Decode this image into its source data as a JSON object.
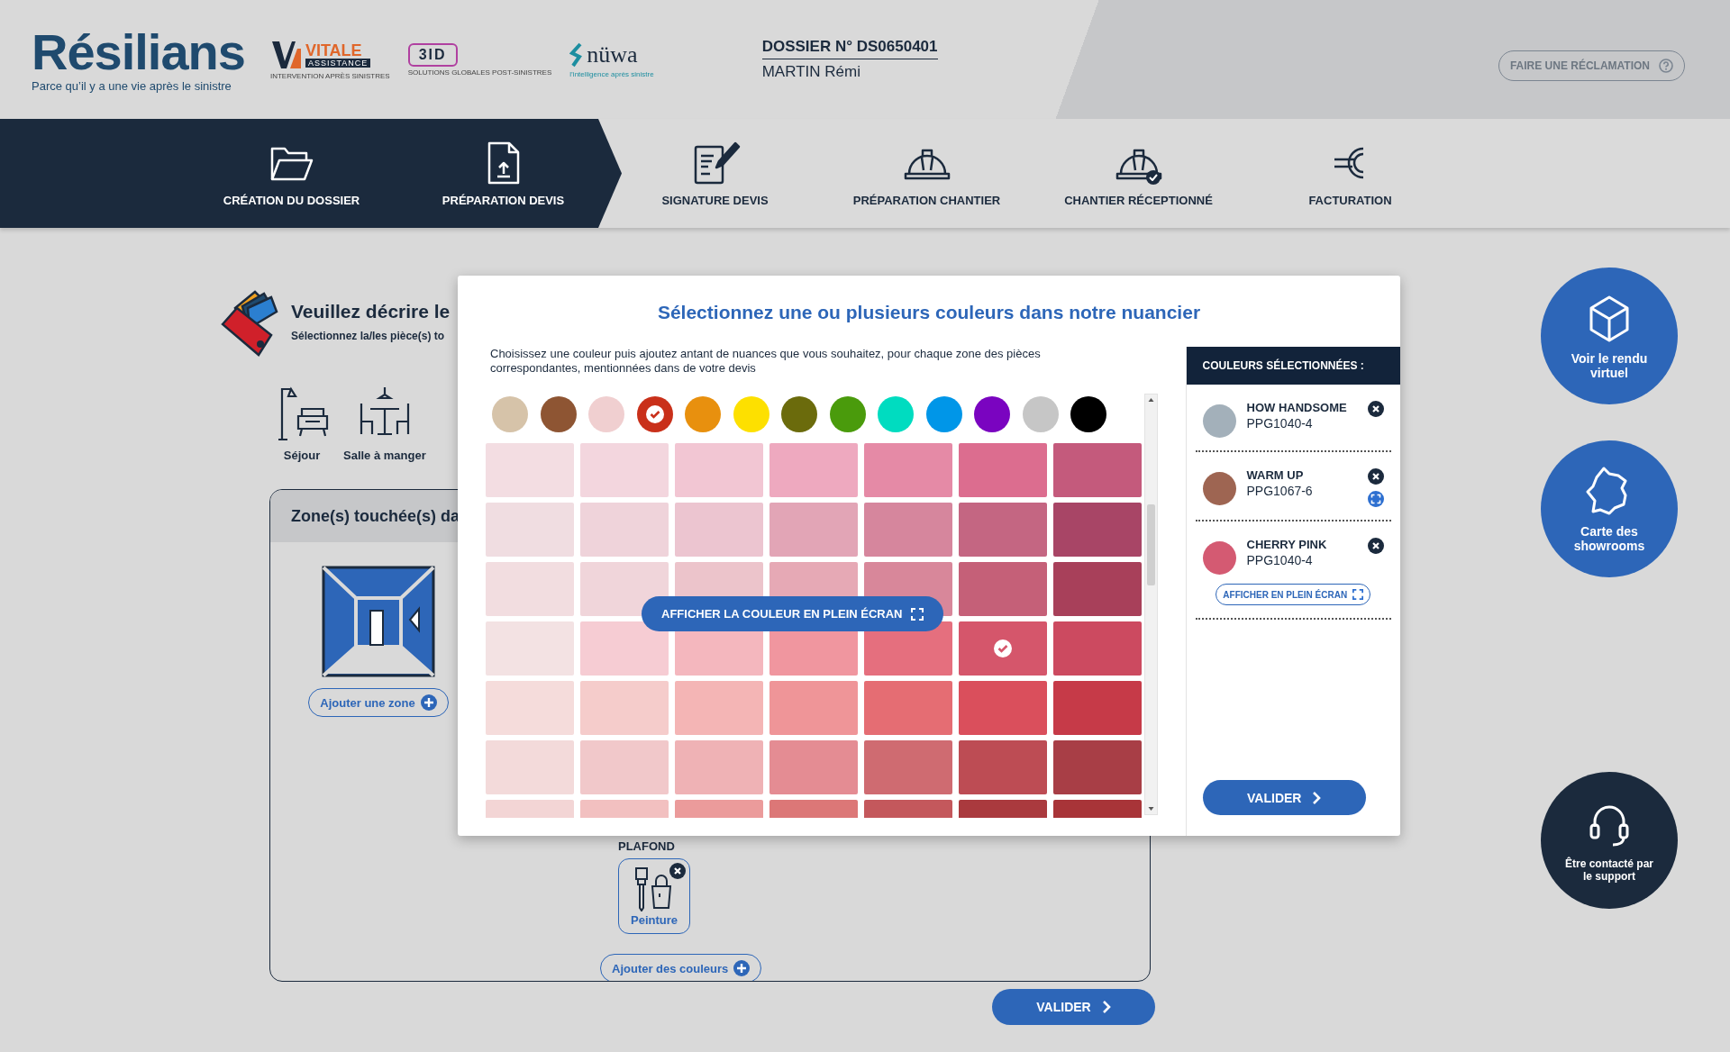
{
  "header": {
    "logo": {
      "name": "Résilians",
      "tagline": "Parce qu’il y a une vie après le sinistre"
    },
    "partners": [
      {
        "kind": "vitale",
        "name": "VITALE",
        "subtitle": "ASSISTANCE",
        "tagline": "INTERVENTION APRÈS SINISTRES"
      },
      {
        "kind": "threeid",
        "name": "3ID",
        "tagline": "SOLUTIONS GLOBALES POST-SINISTRES"
      },
      {
        "kind": "nuwa",
        "name": "nüwa",
        "tagline": "l’intelligence après sinistre"
      }
    ],
    "dossier": {
      "number": "DOSSIER N° DS0650401",
      "client": "MARTIN Rémi"
    },
    "claim_button": "FAIRE UNE RÉCLAMATION"
  },
  "steps": [
    {
      "kind": "folder",
      "label": "CRÉATION DU DOSSIER",
      "done": true
    },
    {
      "kind": "upload",
      "label": "PRÉPARATION DEVIS",
      "done": true
    },
    {
      "kind": "signature",
      "label": "SIGNATURE DEVIS",
      "done": false
    },
    {
      "kind": "helmet",
      "label": "PRÉPARATION CHANTIER",
      "done": false
    },
    {
      "kind": "helmetcheck",
      "label": "CHANTIER RÉCEPTIONNÉ",
      "done": false
    },
    {
      "kind": "euro",
      "label": "FACTURATION",
      "done": false
    }
  ],
  "page": {
    "title": "Veuillez décrire le",
    "subtitle": "Sélectionnez la/les pièce(s) to",
    "rooms": [
      {
        "kind": "living",
        "label": "Séjour"
      },
      {
        "kind": "dining",
        "label": "Salle à manger"
      }
    ],
    "zone_panel": {
      "title": "Zone(s) touchée(s) da",
      "add_zone": "Ajouter une zone",
      "section": "PLAFOND",
      "works": [
        {
          "label": "Peinture"
        }
      ],
      "add_colors": "Ajouter des couleurs"
    },
    "validate": "VALIDER"
  },
  "modal": {
    "title": "Sélectionnez une ou plusieurs couleurs dans notre nuancier",
    "intro": "Choisissez une couleur puis ajoutez antant de nuances que vous souhaitez, pour chaque zone des pièces correspondantes, mentionnées dans de votre devis",
    "swatches": [
      {
        "color": "#d6c3a9",
        "selected": false
      },
      {
        "color": "#8e5533",
        "selected": false
      },
      {
        "color": "#f0cfd0",
        "selected": false
      },
      {
        "color": "#c9301a",
        "selected": true
      },
      {
        "color": "#e8900e",
        "selected": false
      },
      {
        "color": "#fde000",
        "selected": false
      },
      {
        "color": "#6b6b0c",
        "selected": false
      },
      {
        "color": "#4a9b0c",
        "selected": false
      },
      {
        "color": "#00dcc0",
        "selected": false
      },
      {
        "color": "#0096e8",
        "selected": false
      },
      {
        "color": "#7a04c0",
        "selected": false
      },
      {
        "color": "#c6c6c6",
        "selected": false
      },
      {
        "color": "#000000",
        "selected": false
      }
    ],
    "shades": [
      {
        "cells": [
          {
            "color": "#f3dde2",
            "selected": false
          },
          {
            "color": "#f3d6de",
            "selected": false
          },
          {
            "color": "#f2c6d3",
            "selected": false
          },
          {
            "color": "#eea9bf",
            "selected": false
          },
          {
            "color": "#e58aa6",
            "selected": false
          },
          {
            "color": "#dc6d8f",
            "selected": false
          },
          {
            "color": "#c45a7c",
            "selected": false
          }
        ]
      },
      {
        "cells": [
          {
            "color": "#f0dde1",
            "selected": false
          },
          {
            "color": "#efd3da",
            "selected": false
          },
          {
            "color": "#ecc5d0",
            "selected": false
          },
          {
            "color": "#e2a5b6",
            "selected": false
          },
          {
            "color": "#d6869d",
            "selected": false
          },
          {
            "color": "#c46682",
            "selected": false
          },
          {
            "color": "#a84566",
            "selected": false
          }
        ]
      },
      {
        "cells": [
          {
            "color": "#f2dde0",
            "selected": false
          },
          {
            "color": "#f0d5da",
            "selected": false
          },
          {
            "color": "#ecc4cb",
            "selected": false
          },
          {
            "color": "#e6a9b5",
            "selected": false
          },
          {
            "color": "#d8879a",
            "selected": false
          },
          {
            "color": "#c56078",
            "selected": false
          },
          {
            "color": "#a8405a",
            "selected": false
          }
        ]
      },
      {
        "cells": [
          {
            "color": "#f3e2e3",
            "selected": false
          },
          {
            "color": "#f6ccd3",
            "selected": false
          },
          {
            "color": "#f4b7be",
            "selected": false
          },
          {
            "color": "#f0969f",
            "selected": false
          },
          {
            "color": "#e56f7e",
            "selected": false
          },
          {
            "color": "#d5566b",
            "selected": true
          },
          {
            "color": "#cc4a60",
            "selected": false
          }
        ]
      },
      {
        "cells": [
          {
            "color": "#f5dcdb",
            "selected": false
          },
          {
            "color": "#f5cccb",
            "selected": false
          },
          {
            "color": "#f4b5b5",
            "selected": false
          },
          {
            "color": "#ef9598",
            "selected": false
          },
          {
            "color": "#e56d73",
            "selected": false
          },
          {
            "color": "#da4f5c",
            "selected": false
          },
          {
            "color": "#c63a48",
            "selected": false
          }
        ]
      },
      {
        "cells": [
          {
            "color": "#f3dada",
            "selected": false
          },
          {
            "color": "#f1c8ca",
            "selected": false
          },
          {
            "color": "#efb2b5",
            "selected": false
          },
          {
            "color": "#e48c93",
            "selected": false
          },
          {
            "color": "#cf6b71",
            "selected": false
          },
          {
            "color": "#bd4c54",
            "selected": false
          },
          {
            "color": "#a83e46",
            "selected": false
          }
        ]
      },
      {
        "cells": [
          {
            "color": "#f3d5d5"
          },
          {
            "color": "#f2c0c0"
          },
          {
            "color": "#eb9b9b"
          },
          {
            "color": "#dc7777"
          },
          {
            "color": "#c4585c"
          },
          {
            "color": "#aa3a3e"
          },
          {
            "color": "#a83438"
          }
        ]
      }
    ],
    "fullscreen_button": "AFFICHER LA COULEUR EN PLEIN ÉCRAN",
    "selected_panel": {
      "title": "COULEURS SÉLECTIONNÉES :",
      "colors": [
        {
          "name": "HOW HANDSOME",
          "code": "PPG1040-4",
          "color": "#a3b0ba",
          "fullscreen_icon": false
        },
        {
          "name": "WARM UP",
          "code": "PPG1067-6",
          "color": "#9e6552",
          "fullscreen_icon": true
        },
        {
          "name": "CHERRY PINK",
          "code": "PPG1040-4",
          "color": "#d45a72",
          "fullscreen_icon": false,
          "fullscreen_label": "AFFICHER EN PLEIN ÉCRAN"
        }
      ],
      "validate": "VALIDER"
    }
  },
  "side_actions": [
    {
      "kind": "cube",
      "label": "Voir le rendu virtuel"
    },
    {
      "kind": "map",
      "label": "Carte des showrooms"
    },
    {
      "kind": "headset",
      "label": "Être contacté par le support"
    }
  ]
}
